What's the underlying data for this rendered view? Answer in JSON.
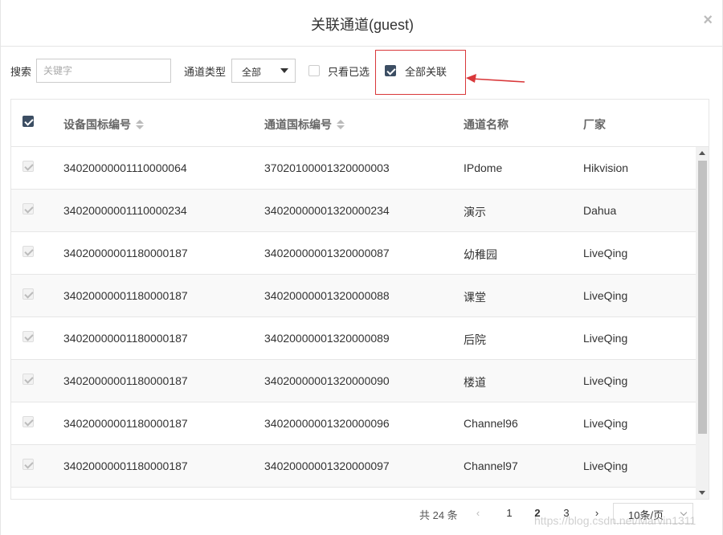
{
  "dialog": {
    "title": "关联通道(guest)",
    "close_glyph": "×"
  },
  "toolbar": {
    "search_label": "搜索",
    "search_placeholder": "关键字",
    "type_label": "通道类型",
    "type_value": "全部",
    "only_selected_label": "只看已选",
    "link_all_label": "全部关联"
  },
  "table": {
    "columns": [
      "设备国标编号",
      "通道国标编号",
      "通道名称",
      "厂家"
    ],
    "rows": [
      {
        "device": "34020000001110000064",
        "channel": "37020100001320000003",
        "name": "IPdome",
        "vendor": "Hikvision"
      },
      {
        "device": "34020000001110000234",
        "channel": "34020000001320000234",
        "name": "演示",
        "vendor": "Dahua"
      },
      {
        "device": "34020000001180000187",
        "channel": "34020000001320000087",
        "name": "幼稚园",
        "vendor": "LiveQing"
      },
      {
        "device": "34020000001180000187",
        "channel": "34020000001320000088",
        "name": "课堂",
        "vendor": "LiveQing"
      },
      {
        "device": "34020000001180000187",
        "channel": "34020000001320000089",
        "name": "后院",
        "vendor": "LiveQing"
      },
      {
        "device": "34020000001180000187",
        "channel": "34020000001320000090",
        "name": "楼道",
        "vendor": "LiveQing"
      },
      {
        "device": "34020000001180000187",
        "channel": "34020000001320000096",
        "name": "Channel96",
        "vendor": "LiveQing"
      },
      {
        "device": "34020000001180000187",
        "channel": "34020000001320000097",
        "name": "Channel97",
        "vendor": "LiveQing"
      }
    ]
  },
  "pagination": {
    "total": "共 24 条",
    "prev": "‹",
    "pages": [
      "1",
      "2",
      "3"
    ],
    "current_page": "2",
    "next": "›",
    "page_size": "10条/页"
  },
  "watermark": "https://blog.csdn.net/Marvin1311",
  "colors": {
    "accent": "#3c4e63",
    "highlight": "#d9383a"
  }
}
